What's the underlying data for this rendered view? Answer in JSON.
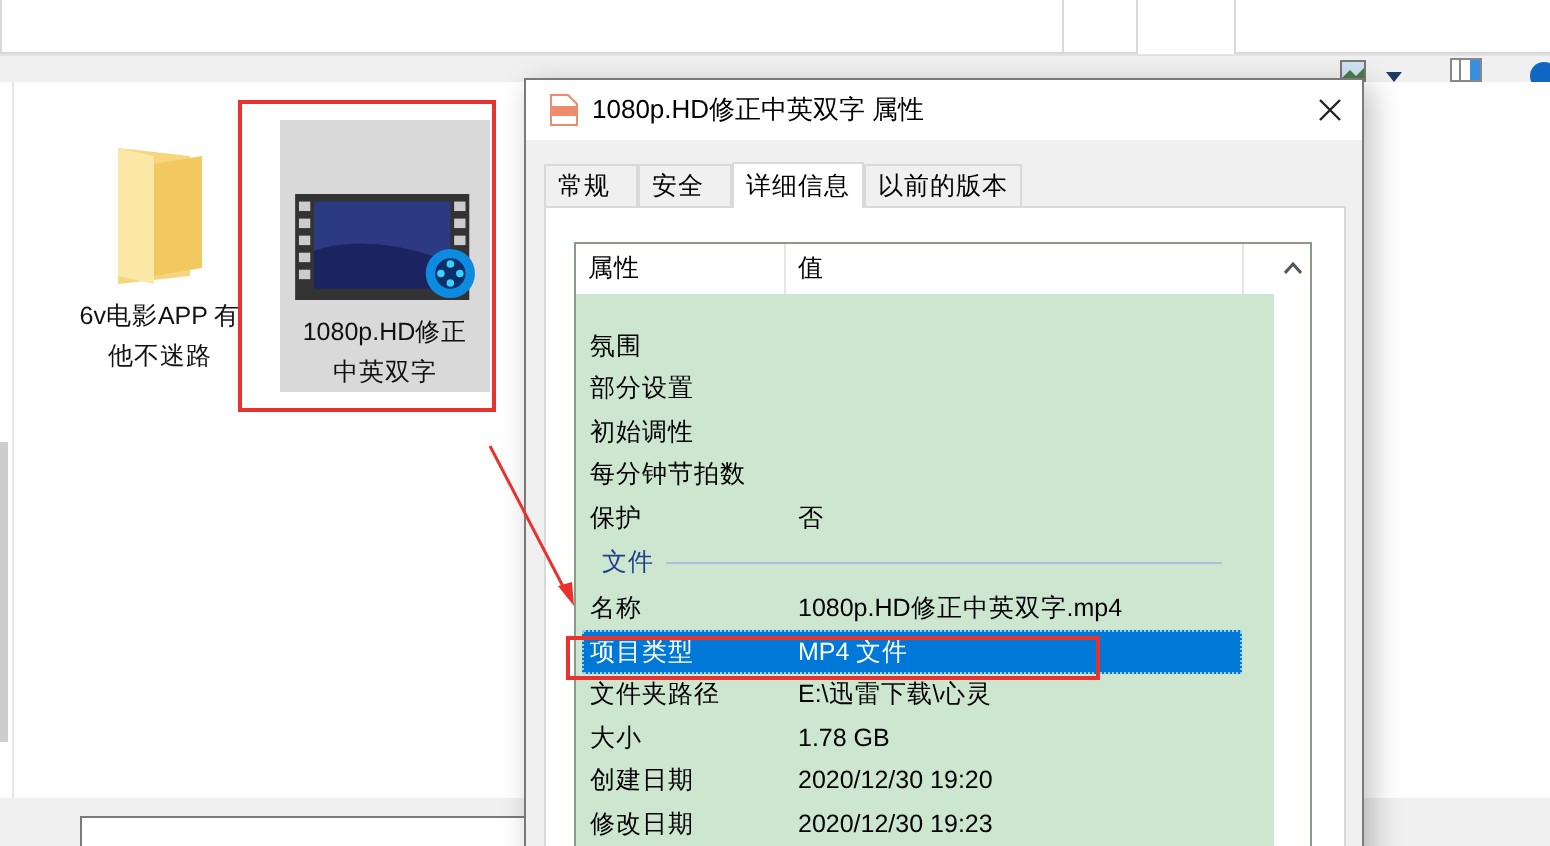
{
  "file_pane": {
    "items": [
      {
        "kind": "folder",
        "label": "6v电影APP 有他不迷路",
        "selected": false
      },
      {
        "kind": "video",
        "label": "1080p.HD修正中英双字",
        "selected": true
      }
    ]
  },
  "dialog": {
    "title": "1080p.HD修正中英双字 属性",
    "tabs": [
      {
        "label": "常规",
        "selected": false
      },
      {
        "label": "安全",
        "selected": false
      },
      {
        "label": "详细信息",
        "selected": true
      },
      {
        "label": "以前的版本",
        "selected": false
      }
    ],
    "columns": [
      "属性",
      "值"
    ],
    "rows": [
      {
        "kind": "property",
        "name": "氛围",
        "selected": false
      },
      {
        "kind": "property",
        "name": "部分设置",
        "selected": false
      },
      {
        "kind": "property",
        "name": "初始调性",
        "selected": false
      },
      {
        "kind": "property",
        "name": "每分钟节拍数",
        "selected": false
      },
      {
        "kind": "property",
        "name": "保护",
        "value": "否",
        "selected": false
      },
      {
        "kind": "group",
        "name": "文件"
      },
      {
        "kind": "property",
        "name": "名称",
        "value": "1080p.HD修正中英双字.mp4",
        "selected": false
      },
      {
        "kind": "property",
        "name": "项目类型",
        "value": "MP4 文件",
        "selected": true
      },
      {
        "kind": "property",
        "name": "文件夹路径",
        "value": "E:\\迅雷下载\\心灵",
        "selected": false
      },
      {
        "kind": "property",
        "name": "大小",
        "value": "1.78 GB",
        "selected": false
      },
      {
        "kind": "property",
        "name": "创建日期",
        "value": "2020/12/30 19:20",
        "selected": false
      },
      {
        "kind": "property",
        "name": "修改日期",
        "value": "2020/12/30 19:23",
        "selected": false
      }
    ]
  }
}
